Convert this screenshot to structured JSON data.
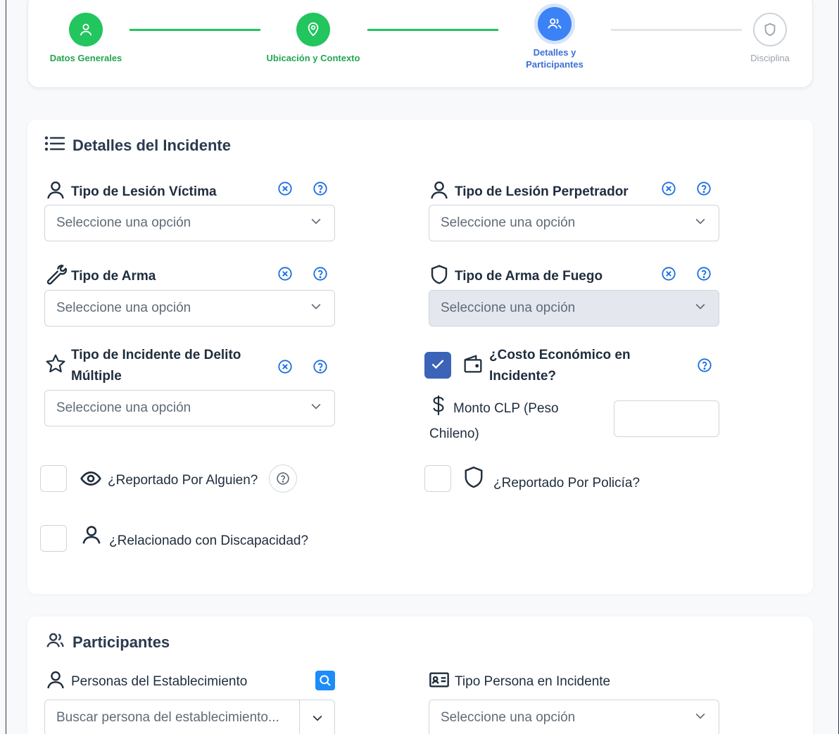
{
  "stepper": {
    "steps": [
      {
        "label": "Datos Generales",
        "state": "done",
        "icon": "user-icon"
      },
      {
        "label": "Ubicación y Contexto",
        "state": "done",
        "icon": "location-pin-icon"
      },
      {
        "label": "Detalles y\nParticipantes",
        "state": "active",
        "icon": "users-icon"
      },
      {
        "label": "Disciplina",
        "state": "pending",
        "icon": "shield-icon"
      }
    ]
  },
  "colors": {
    "done": "#22c55e",
    "active": "#3b82f6",
    "pending": "#cfd4db",
    "accent_blue": "#1d8cf8"
  },
  "detalles": {
    "title": "Detalles del Incidente",
    "lesion_victima": {
      "label": "Tipo de Lesión Víctima",
      "value": "Seleccione una opción"
    },
    "lesion_perpetrador": {
      "label": "Tipo de Lesión Perpetrador",
      "value": "Seleccione una opción"
    },
    "arma": {
      "label": "Tipo de Arma",
      "value": "Seleccione una opción"
    },
    "arma_fuego": {
      "label": "Tipo de Arma de Fuego",
      "value": "Seleccione una opción",
      "disabled": true
    },
    "delito_multiple": {
      "label_line1": "Tipo de Incidente de Delito",
      "label_line2": "Múltiple",
      "value": "Seleccione una opción"
    },
    "costo_economico": {
      "label_line1": "¿Costo Económico en",
      "label_line2": "Incidente?",
      "checked": true
    },
    "monto": {
      "label_line1": "Monto CLP (Peso",
      "label_line2": "Chileno)",
      "value": ""
    },
    "reportado_alguien": {
      "label": "¿Reportado Por Alguien?",
      "checked": false
    },
    "reportado_policia": {
      "label": "¿Reportado Por Policía?",
      "checked": false
    },
    "discapacidad": {
      "label": "¿Relacionado con Discapacidad?",
      "checked": false
    }
  },
  "participantes": {
    "title": "Participantes",
    "personas": {
      "label": "Personas del Establecimiento",
      "placeholder": "Buscar persona del establecimiento..."
    },
    "tipo_persona": {
      "label": "Tipo Persona en Incidente",
      "value": "Seleccione una opción"
    }
  }
}
